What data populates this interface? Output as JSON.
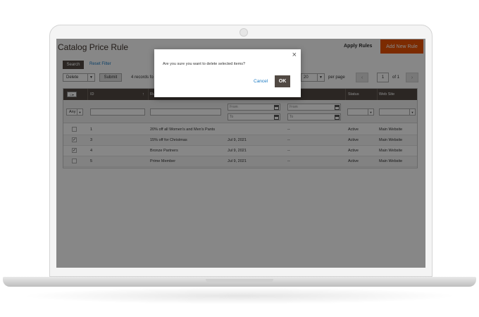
{
  "page": {
    "title": "Catalog Price Rule",
    "apply_rules": "Apply Rules",
    "add_rule": "Add New Rule"
  },
  "toolbar": {
    "search": "Search",
    "reset_filter": "Reset Filter",
    "action": "Delete",
    "submit": "Submit",
    "records_found": "4 records fo",
    "per_page_value": "20",
    "per_page_label": "per page",
    "prev": "‹",
    "next": "›",
    "current_page": "1",
    "of_pages": "of 1"
  },
  "grid": {
    "headers": {
      "mass": "",
      "id": "ID",
      "rule": "Ru",
      "status": "Status",
      "website": "Web Site"
    },
    "filters": {
      "mass": "Any",
      "from": "From",
      "to": "To"
    },
    "rows": [
      {
        "checked": "",
        "id": "1",
        "name": "20% off all Women's and Men's Pants",
        "date": "",
        "end": "--",
        "status": "Active",
        "website": "Main Website"
      },
      {
        "checked": "✓",
        "id": "3",
        "name": "15% off for Christmas",
        "date": "Jul 9, 2021",
        "end": "--",
        "status": "Active",
        "website": "Main Website"
      },
      {
        "checked": "✓",
        "id": "4",
        "name": "Bronze Partners",
        "date": "Jul 9, 2021",
        "end": "--",
        "status": "Active",
        "website": "Main Website"
      },
      {
        "checked": "",
        "id": "5",
        "name": "Prime Member",
        "date": "Jul 9, 2021",
        "end": "--",
        "status": "Active",
        "website": "Main Website"
      }
    ]
  },
  "modal": {
    "message": "Are you sure you want to delete selected items?",
    "cancel": "Cancel",
    "ok": "OK",
    "close": "×"
  },
  "colors": {
    "accent": "#eb5202",
    "header": "#514943",
    "link": "#1979c3"
  }
}
